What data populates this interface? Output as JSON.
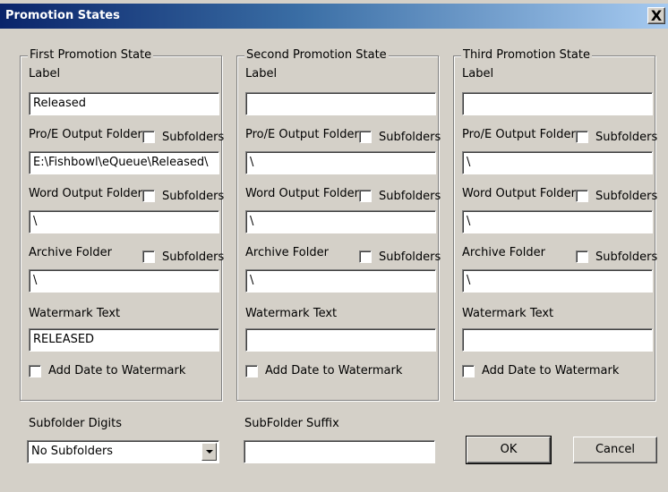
{
  "window": {
    "title": "Promotion States",
    "close_glyph": "X"
  },
  "labels": {
    "label": "Label",
    "proe_folder": "Pro/E Output Folder",
    "word_folder": "Word Output Folder",
    "archive_folder": "Archive Folder",
    "watermark": "Watermark Text",
    "add_date": "Add Date to Watermark",
    "subfolders": "Subfolders"
  },
  "groups": [
    {
      "title": "First Promotion State",
      "label": "Released",
      "proe_folder": "E:\\Fishbowl\\eQueue\\Released\\",
      "word_folder": "\\",
      "archive_folder": "\\",
      "watermark": "RELEASED"
    },
    {
      "title": "Second Promotion State",
      "label": "",
      "proe_folder": "\\",
      "word_folder": "\\",
      "archive_folder": "\\",
      "watermark": ""
    },
    {
      "title": "Third Promotion State",
      "label": "",
      "proe_folder": "\\",
      "word_folder": "\\",
      "archive_folder": "\\",
      "watermark": ""
    }
  ],
  "footer": {
    "digits_label": "Subfolder Digits",
    "digits_value": "No Subfolders",
    "suffix_label": "SubFolder Suffix",
    "suffix_value": "",
    "ok_label": "OK",
    "cancel_label": "Cancel"
  }
}
